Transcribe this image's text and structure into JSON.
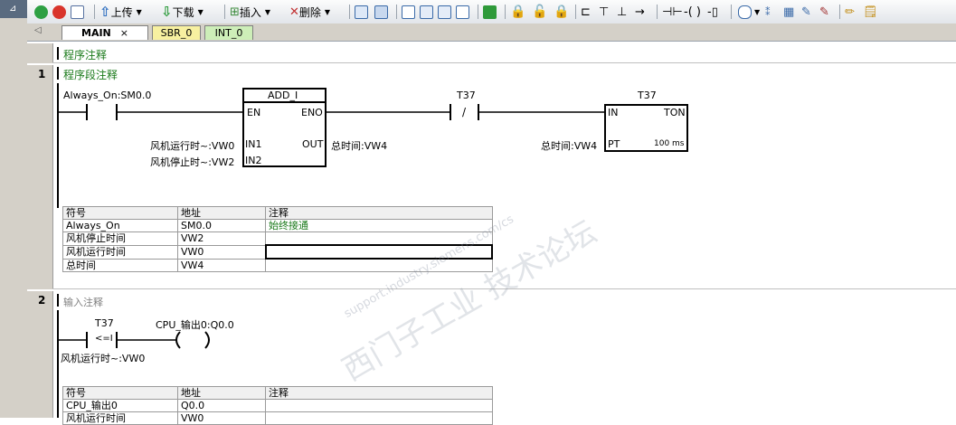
{
  "toolbar": {
    "upload_label": "上传",
    "download_label": "下载",
    "insert_label": "插入",
    "delete_label": "删除"
  },
  "tabs": [
    {
      "label": "MAIN"
    },
    {
      "label": "SBR_0"
    },
    {
      "label": "INT_0"
    }
  ],
  "program_comment": "程序注释",
  "networks": [
    {
      "number": "1",
      "comment": "程序段注释",
      "contact1_operand": "Always_On:SM0.0",
      "add_box": {
        "title": "ADD_I",
        "en": "EN",
        "eno": "ENO",
        "in1": "IN1",
        "in2": "IN2",
        "out": "OUT"
      },
      "in1_operand": "风机运行时~:VW0",
      "in2_operand": "风机停止时~:VW2",
      "out_operand": "总时间:VW4",
      "contact2_operand": "T37",
      "contact2_symbol": "/",
      "timer_box": {
        "title": "T37",
        "in": "IN",
        "type": "TON",
        "pt": "PT",
        "unit": "100 ms"
      },
      "pt_operand": "总时间:VW4",
      "symbol_table": {
        "headers": [
          "符号",
          "地址",
          "注释"
        ],
        "rows": [
          [
            "Always_On",
            "SM0.0",
            "始终接通"
          ],
          [
            "风机停止时间",
            "VW2",
            ""
          ],
          [
            "风机运行时间",
            "VW0",
            ""
          ],
          [
            "总时间",
            "VW4",
            ""
          ]
        ]
      }
    },
    {
      "number": "2",
      "comment": "输入注释",
      "contact_operand_top": "T37",
      "contact_symbol": "<=I",
      "contact_operand_bottom": "风机运行时~:VW0",
      "coil_operand": "CPU_输出0:Q0.0",
      "symbol_table": {
        "headers": [
          "符号",
          "地址",
          "注释"
        ],
        "rows": [
          [
            "CPU_输出0",
            "Q0.0",
            ""
          ],
          [
            "风机运行时间",
            "VW0",
            ""
          ]
        ]
      }
    }
  ],
  "watermark": {
    "line1": "西门子工业  技术论坛",
    "line2": "support.industry.siemens.com/cs"
  }
}
